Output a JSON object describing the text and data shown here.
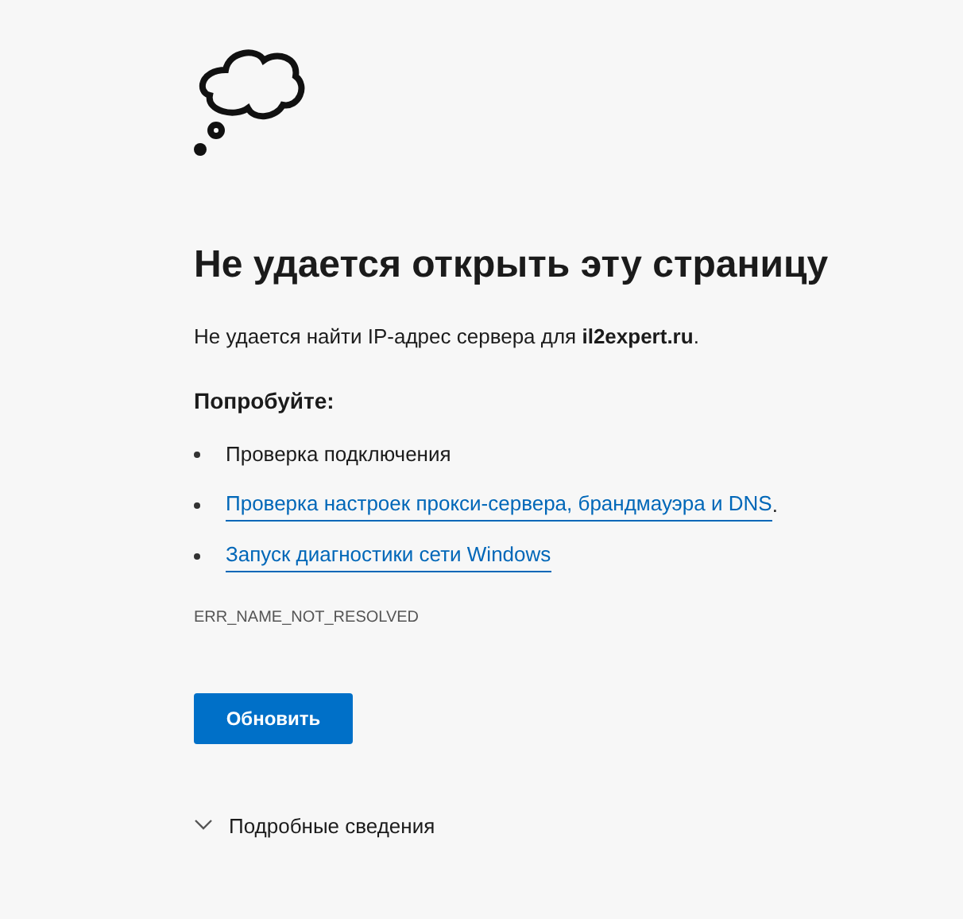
{
  "heading": "Не удается открыть эту страницу",
  "message": "Не удается найти IP-адрес сервера для **il2expert.ru**.",
  "suggestions_title": "Попробуйте:",
  "suggestions": [
    {
      "kind": "text",
      "text": "Проверка подключения"
    },
    {
      "kind": "link",
      "text": "Проверка настроек прокси-сервера, брандмауэра и DNS",
      "after": "."
    },
    {
      "kind": "link",
      "text": "Запуск диагностики сети Windows"
    }
  ],
  "error_code": "ERR_NAME_NOT_RESOLVED",
  "button": "Обновить",
  "details": {
    "label": "Подробные сведения",
    "expanded": false
  }
}
